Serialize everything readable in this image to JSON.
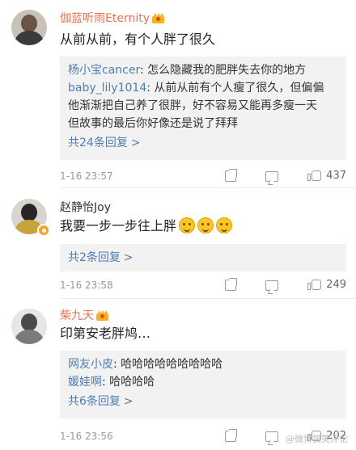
{
  "comments": [
    {
      "username": "伽蓝听雨Eternity",
      "text": "从前从前，有个人胖了很久",
      "replies": [
        {
          "user": "杨小宝cancer",
          "text": ": 怎么隐藏我的肥胖失去你的地方"
        },
        {
          "user": "baby_lily1014",
          "text_1": ": 从前从前有个人瘦了很久，但偏偏",
          "text_2": "他渐渐把自己养了很胖，好不容易又能再多瘦一天",
          "text_3": "但故事的最后你好像还是说了拜拜"
        }
      ],
      "more": "共24条回复",
      "time": "1-16 23:57",
      "likes": "437"
    },
    {
      "username": "赵静怡Joy",
      "text": "我要一步一步往上胖",
      "more": "共2条回复",
      "time": "1-16 23:58",
      "likes": "249"
    },
    {
      "username": "柴九天",
      "text": "印第安老胖鸠…",
      "replies": [
        {
          "user": "网友小皮",
          "text": ": 哈哈哈哈哈哈哈哈哈"
        },
        {
          "user": "媛娃啊",
          "text": ": 哈哈哈哈"
        }
      ],
      "more": "共6条回复",
      "time": "1-16 23:56",
      "likes": "202"
    }
  ],
  "chevron": ">",
  "watermark": "@微博搞笑评论",
  "colors": {
    "link": "#507daf",
    "vip_name": "#eb7350",
    "meta": "#999999",
    "reply_bg": "#f2f2f2"
  },
  "icons": [
    "share-icon",
    "comment-icon",
    "like-icon",
    "crown-icon",
    "emoji-icon",
    "vip-badge-icon"
  ]
}
